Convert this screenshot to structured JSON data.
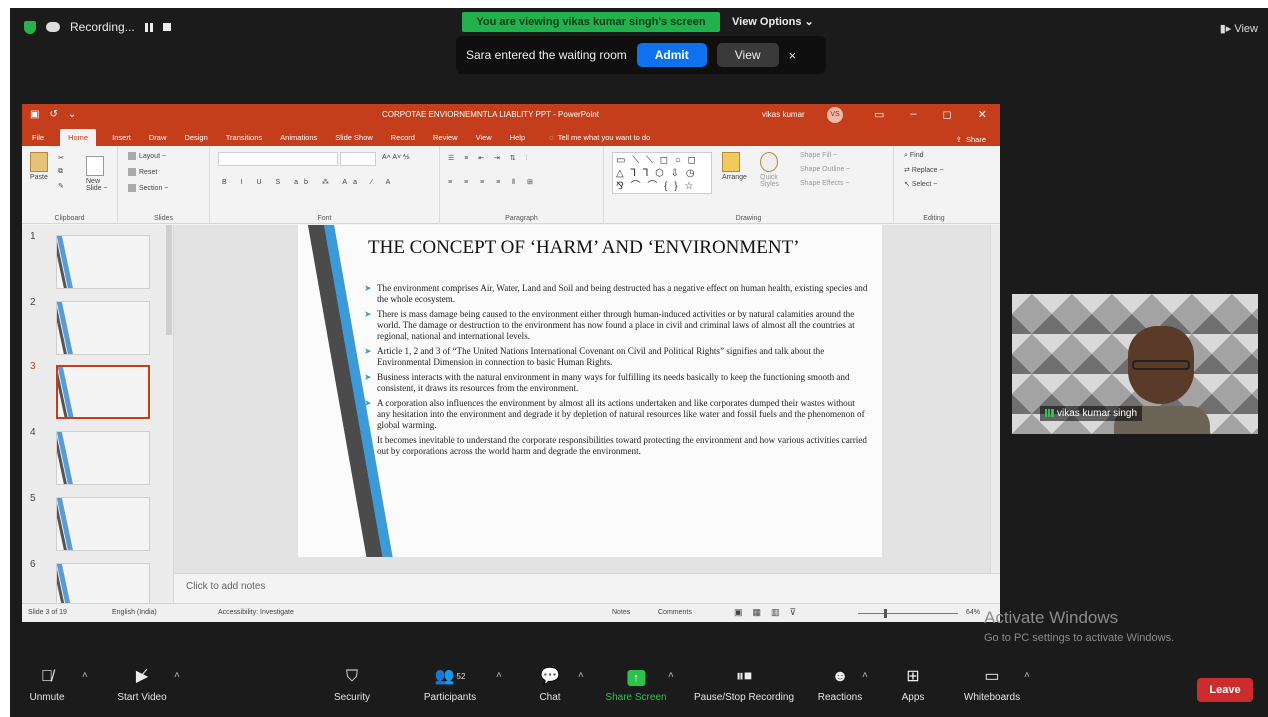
{
  "zoom": {
    "recording_label": "Recording...",
    "viewing_banner": "You are viewing vikas kumar singh's screen",
    "view_options": "View Options ⌄",
    "top_view": "View",
    "notification": {
      "text": "Sara entered the waiting room",
      "admit": "Admit",
      "view": "View",
      "close": "×"
    },
    "video": {
      "name": "vikas kumar singh"
    },
    "toolbar": {
      "unmute": "Unmute",
      "start_video": "Start Video",
      "security": "Security",
      "participants": "Participants",
      "participants_count": "52",
      "chat": "Chat",
      "share_screen": "Share Screen",
      "pause_recording": "Pause/Stop Recording",
      "reactions": "Reactions",
      "apps": "Apps",
      "whiteboards": "Whiteboards",
      "leave": "Leave"
    },
    "activate": {
      "title": "Activate Windows",
      "sub": "Go to PC settings to activate Windows."
    }
  },
  "ppt": {
    "title": "CORPOTAE ENVIORNEMNTLA LIABLITY PPT  -  PowerPoint",
    "user": "vikas kumar",
    "avatar": "VS",
    "tabs": [
      "File",
      "Home",
      "Insert",
      "Draw",
      "Design",
      "Transitions",
      "Animations",
      "Slide Show",
      "Record",
      "Review",
      "View",
      "Help"
    ],
    "tell_me": "Tell me what you want to do",
    "share": "Share",
    "ribbon": {
      "paste": "Paste",
      "clipboard": "Clipboard",
      "new_slide": "New Slide ~",
      "layout": "Layout ~",
      "reset": "Reset",
      "section": "Section ~",
      "slides": "Slides",
      "font": "Font",
      "paragraph": "Paragraph",
      "arrange": "Arrange",
      "quick_styles": "Quick Styles",
      "shape_fill": "Shape Fill ~",
      "shape_outline": "Shape Outline ~",
      "shape_effects": "Shape Effects ~",
      "drawing": "Drawing",
      "find": "Find",
      "replace": "Replace ~",
      "select": "Select ~",
      "editing": "Editing"
    },
    "thumbnails": [
      "1",
      "2",
      "3",
      "4",
      "5",
      "6"
    ],
    "selected_slide": 3,
    "slide": {
      "title": "THE CONCEPT OF ‘HARM’ AND ‘ENVIRONMENT’",
      "bullets": [
        "The environment comprises Air, Water, Land and Soil and being destructed has a negative effect on human health, existing species and the whole ecosystem.",
        "There is mass damage being caused to the environment either through human-induced activities or by natural calamities around the world. The damage or destruction to the environment has now found a place in civil and criminal laws of almost all the countries at regional, national and international levels.",
        "Article 1, 2 and 3 of “The United Nations International Covenant on Civil and Political Rights” signifies and talk about the Environmental Dimension in connection to basic Human Rights.",
        "Business interacts with the natural environment in many ways for fulfilling its needs basically to keep the functioning smooth and consistent, it draws its resources from the environment.",
        "A corporation also influences the environment by almost all its actions undertaken and like corporates dumped their wastes without any hesitation into the environment and degrade it by depletion of natural resources like water and fossil fuels and the phenomenon of global warming.",
        "It becomes inevitable to understand the corporate responsibilities toward protecting the environment and how various activities carried out by corporations across the world harm and degrade the environment."
      ]
    },
    "notes_placeholder": "Click to add notes",
    "status": {
      "slide_of": "Slide 3 of 19",
      "language": "English (India)",
      "accessibility": "Accessibility: Investigate",
      "notes": "Notes",
      "comments": "Comments",
      "zoom": "64%"
    }
  }
}
